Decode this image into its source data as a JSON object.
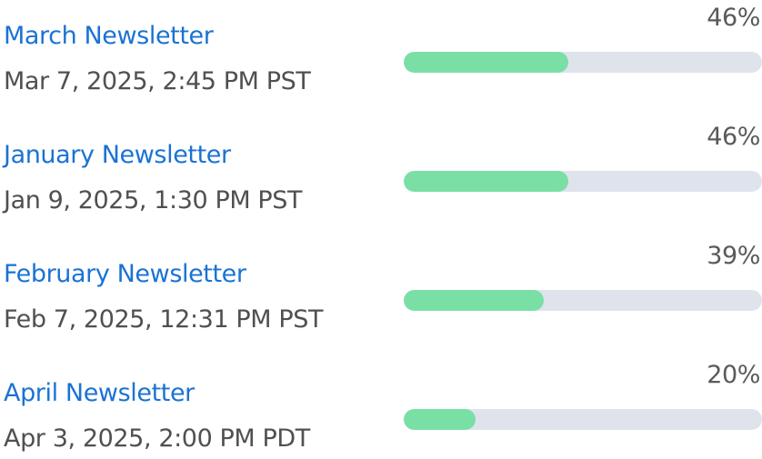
{
  "items": [
    {
      "title": "March Newsletter",
      "date": "Mar 7, 2025, 2:45 PM PST",
      "percent_label": "46%",
      "bar_fill": 0.46
    },
    {
      "title": "January Newsletter",
      "date": "Jan 9, 2025, 1:30 PM PST",
      "percent_label": "46%",
      "bar_fill": 0.46
    },
    {
      "title": "February Newsletter",
      "date": "Feb 7, 2025, 12:31 PM PST",
      "percent_label": "39%",
      "bar_fill": 0.39
    },
    {
      "title": "April Newsletter",
      "date": "Apr 3, 2025, 2:00 PM PDT",
      "percent_label": "20%",
      "bar_fill": 0.2
    }
  ],
  "colors": {
    "link": "#1a73d4",
    "muted_text": "#505050",
    "bar_fill": "#7adfa5",
    "bar_track": "#dfe3ec"
  }
}
